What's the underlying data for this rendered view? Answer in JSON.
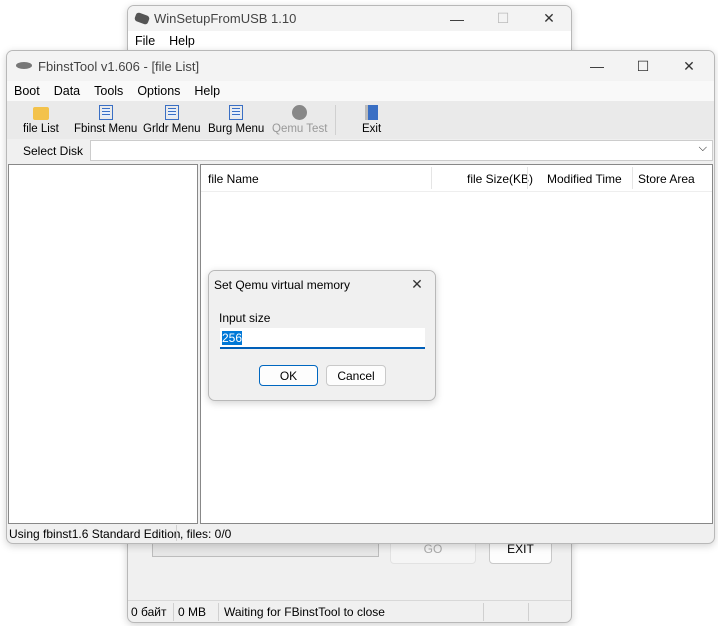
{
  "back_window": {
    "title": "WinSetupFromUSB 1.10",
    "menu": [
      "File",
      "Help"
    ],
    "go_label": "GO",
    "exit_label": "EXIT",
    "status": [
      "0 байт",
      "0 MB",
      "Waiting for FBinstTool to close"
    ]
  },
  "main_window": {
    "title": "FbinstTool v1.606 - [file List]",
    "menu": [
      "Boot",
      "Data",
      "Tools",
      "Options",
      "Help"
    ],
    "toolbar": [
      "file List",
      "Fbinst Menu",
      "Grldr Menu",
      "Burg Menu",
      "Qemu Test",
      "Exit"
    ],
    "select_disk_label": "Select Disk",
    "select_disk_value": "",
    "columns": [
      "file Name",
      "file Size(KB)",
      "Modified Time",
      "Store Area"
    ],
    "status": [
      "Using fbinst1.6 Standard Edition",
      ", files: 0/0"
    ]
  },
  "dialog": {
    "title": "Set Qemu virtual memory",
    "label": "Input size",
    "value": "256",
    "ok": "OK",
    "cancel": "Cancel"
  }
}
